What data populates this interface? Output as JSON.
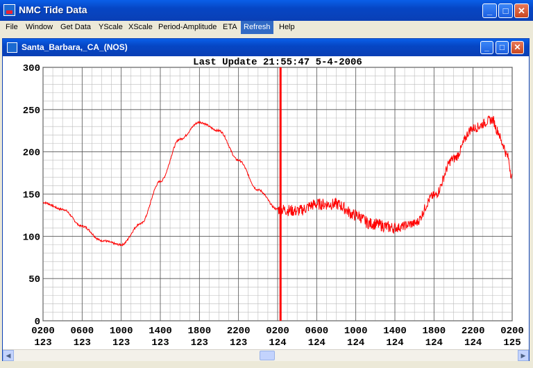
{
  "app": {
    "title": "NMC Tide Data"
  },
  "window_buttons": {
    "minimize": "_",
    "maximize": "□",
    "close": "✕"
  },
  "menu": [
    "File",
    "Window",
    "Get Data",
    "YScale",
    "XScale",
    "Period-Amplitude",
    "ETA",
    "Refresh",
    "Help"
  ],
  "menu_active": "Refresh",
  "child_window": {
    "title": "Santa_Barbara,_CA_(NOS)"
  },
  "chart_data": {
    "type": "line",
    "title": "Last Update   21:55:47    5-4-2006",
    "ylim": [
      0,
      300
    ],
    "yticks": [
      0,
      50,
      100,
      150,
      200,
      250,
      300
    ],
    "xticks": [
      {
        "time": "0200",
        "day": "123"
      },
      {
        "time": "0600",
        "day": "123"
      },
      {
        "time": "1000",
        "day": "123"
      },
      {
        "time": "1400",
        "day": "123"
      },
      {
        "time": "1800",
        "day": "123"
      },
      {
        "time": "2200",
        "day": "123"
      },
      {
        "time": "0200",
        "day": "124"
      },
      {
        "time": "0600",
        "day": "124"
      },
      {
        "time": "1000",
        "day": "124"
      },
      {
        "time": "1400",
        "day": "124"
      },
      {
        "time": "1800",
        "day": "124"
      },
      {
        "time": "2200",
        "day": "124"
      },
      {
        "time": "0200",
        "day": "125"
      }
    ],
    "xrange_hours": [
      0,
      48
    ],
    "grid": true,
    "current_time_marker_hours": 24.3,
    "line_color": "#ff0000",
    "marker_color": "#ff0000",
    "series": [
      {
        "hours": [
          0,
          2,
          4,
          6,
          8,
          10,
          12,
          14,
          16,
          18,
          20,
          22,
          24,
          26,
          28,
          30,
          32,
          33.5,
          36,
          38,
          40,
          42,
          44,
          46
        ],
        "values": [
          140,
          132,
          112,
          95,
          90,
          115,
          165,
          215,
          235,
          225,
          190,
          155,
          132,
          130,
          138,
          138,
          125,
          115,
          110,
          115,
          148,
          192,
          228,
          238
        ],
        "end_values": [
          {
            "hours": 46.5,
            "value": 225
          },
          {
            "hours": 47,
            "value": 210
          },
          {
            "hours": 47.5,
            "value": 195
          },
          {
            "hours": 48,
            "value": 170
          }
        ]
      }
    ]
  }
}
